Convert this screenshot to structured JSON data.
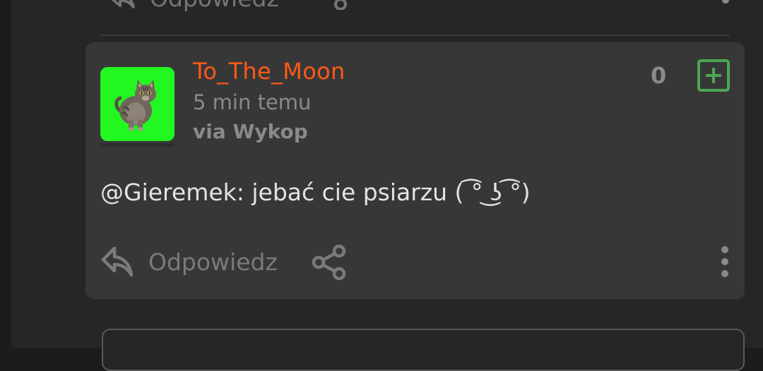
{
  "previous_comment": {
    "reply_label": "Odpowiedz"
  },
  "comment": {
    "username": "To_The_Moon",
    "time": "5 min temu",
    "via": "via Wykop",
    "vote_count": "0",
    "mention": "@Gieremek",
    "text": ": jebać cie psiarzu ( ͡° ͜ʖ ͡°)",
    "reply_label": "Odpowiedz"
  },
  "colors": {
    "username": "#ff5917",
    "vote_plus": "#4ca651",
    "avatar_bg": "#22f722"
  }
}
